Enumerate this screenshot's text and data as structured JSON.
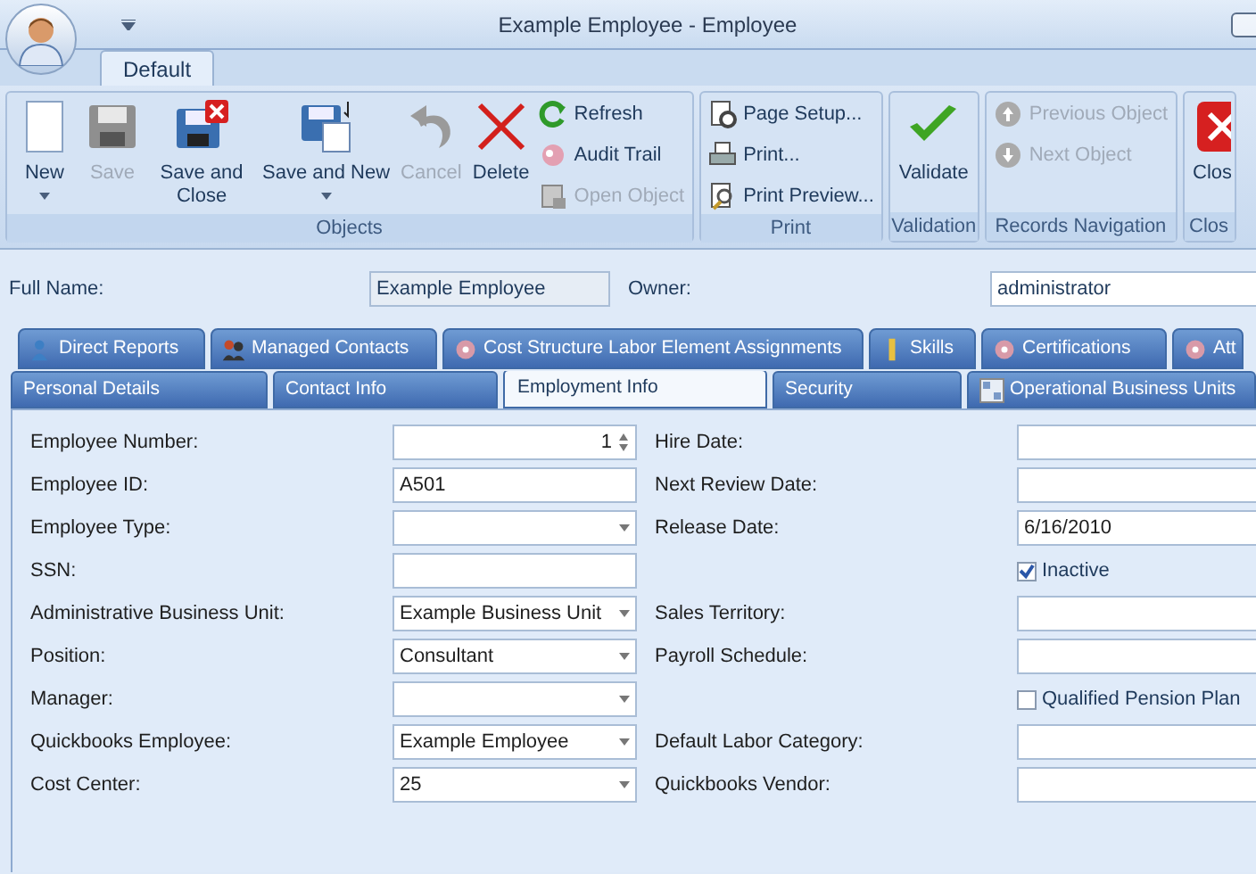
{
  "window": {
    "title": "Example Employee - Employee"
  },
  "ribbon_tabs": [
    {
      "label": "Default",
      "selected": true
    }
  ],
  "ribbon_groups": [
    {
      "label": "Objects",
      "items": [
        {
          "kind": "large",
          "label": "New",
          "dropdown": true,
          "disabled": false
        },
        {
          "kind": "large",
          "label": "Save",
          "dropdown": false,
          "disabled": true
        },
        {
          "kind": "large",
          "label": "Save and Close",
          "dropdown": false,
          "disabled": false
        },
        {
          "kind": "large",
          "label": "Save and New",
          "dropdown": true,
          "disabled": false
        },
        {
          "kind": "large",
          "label": "Cancel",
          "dropdown": false,
          "disabled": true
        },
        {
          "kind": "large",
          "label": "Delete",
          "dropdown": false,
          "disabled": false
        },
        {
          "kind": "small",
          "label": "Refresh",
          "disabled": false
        },
        {
          "kind": "small",
          "label": "Audit Trail",
          "disabled": false
        },
        {
          "kind": "small",
          "label": "Open Object",
          "disabled": true
        }
      ]
    },
    {
      "label": "Print",
      "items": [
        {
          "kind": "small",
          "label": "Page Setup...",
          "disabled": false
        },
        {
          "kind": "small",
          "label": "Print...",
          "disabled": false
        },
        {
          "kind": "small",
          "label": "Print Preview...",
          "disabled": false
        }
      ]
    },
    {
      "label": "Validation",
      "items": [
        {
          "kind": "large",
          "label": "Validate",
          "dropdown": false,
          "disabled": false
        }
      ]
    },
    {
      "label": "Records Navigation",
      "items": [
        {
          "kind": "small",
          "label": "Previous Object",
          "disabled": true
        },
        {
          "kind": "small",
          "label": "Next Object",
          "disabled": true
        }
      ]
    },
    {
      "label": "Clos",
      "items": [
        {
          "kind": "large",
          "label": "Clos",
          "dropdown": false,
          "disabled": false
        }
      ]
    }
  ],
  "header": {
    "full_name_label": "Full Name:",
    "full_name": "Example Employee",
    "owner_label": "Owner:",
    "owner": "administrator"
  },
  "tabs_row_1": [
    {
      "label": "Direct Reports",
      "selected": false
    },
    {
      "label": "Managed Contacts",
      "selected": false
    },
    {
      "label": "Cost Structure Labor Element Assignments",
      "selected": false
    },
    {
      "label": "Skills",
      "selected": false
    },
    {
      "label": "Certifications",
      "selected": false
    },
    {
      "label": "Att",
      "selected": false
    }
  ],
  "tabs_row_2": [
    {
      "label": "Personal Details",
      "selected": false
    },
    {
      "label": "Contact Info",
      "selected": false
    },
    {
      "label": "Employment Info",
      "selected": true
    },
    {
      "label": "Security",
      "selected": false
    },
    {
      "label": "Operational Business Units",
      "selected": false
    }
  ],
  "left_fields": [
    {
      "kind": "spin",
      "label": "Employee Number:",
      "value": "1"
    },
    {
      "kind": "text",
      "label": "Employee ID:",
      "value": "A501"
    },
    {
      "kind": "dropdown",
      "label": "Employee Type:"
    },
    {
      "kind": "text",
      "label": "SSN:"
    },
    {
      "kind": "dropdown",
      "label": "Administrative Business Unit:",
      "value": "Example Business Unit"
    },
    {
      "kind": "dropdown",
      "label": "Position:",
      "value": "Consultant"
    },
    {
      "kind": "dropdown",
      "label": "Manager:"
    },
    {
      "kind": "dropdown",
      "label": "Quickbooks Employee:",
      "value": "Example Employee"
    },
    {
      "kind": "dropdown",
      "label": "Cost Center:",
      "value": "25"
    }
  ],
  "right_fields": [
    {
      "kind": "text",
      "label": "Hire Date:"
    },
    {
      "kind": "text",
      "label": "Next Review Date:"
    },
    {
      "kind": "text",
      "label": "Release Date:",
      "value": "6/16/2010"
    },
    {
      "kind": "checkbox",
      "label": "Inactive",
      "checked": true
    },
    {
      "kind": "text",
      "label": "Sales Territory:"
    },
    {
      "kind": "text",
      "label": "Payroll Schedule:"
    },
    {
      "kind": "checkbox",
      "label": "Qualified Pension Plan",
      "checked": false
    },
    {
      "kind": "text",
      "label": "Default Labor Category:"
    },
    {
      "kind": "text",
      "label": "Quickbooks Vendor:"
    }
  ]
}
